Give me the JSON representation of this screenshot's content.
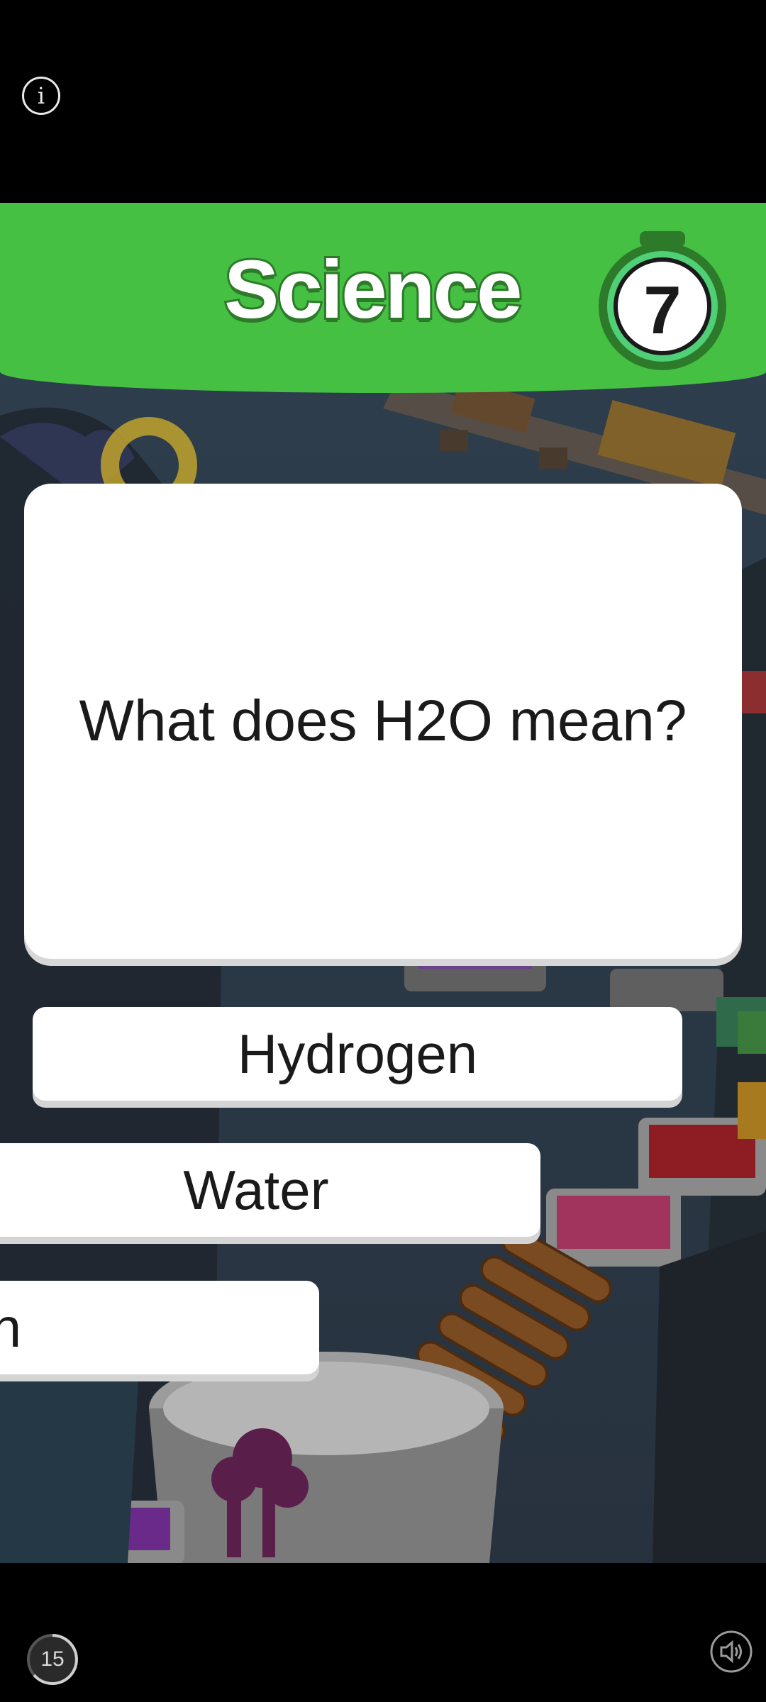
{
  "top_bar": {
    "info_label": "i"
  },
  "header": {
    "subject": "Science",
    "timer_value": "7",
    "accent": "#45c043"
  },
  "question": {
    "text": "What does H2O mean?"
  },
  "answers": [
    {
      "label": "Hydrogen"
    },
    {
      "label": "Water"
    },
    {
      "label": "gen"
    }
  ],
  "bottom_bar": {
    "countdown": "15"
  },
  "icons": {
    "info": "info-icon",
    "sound": "speaker-icon",
    "timer": "stopwatch-icon"
  }
}
